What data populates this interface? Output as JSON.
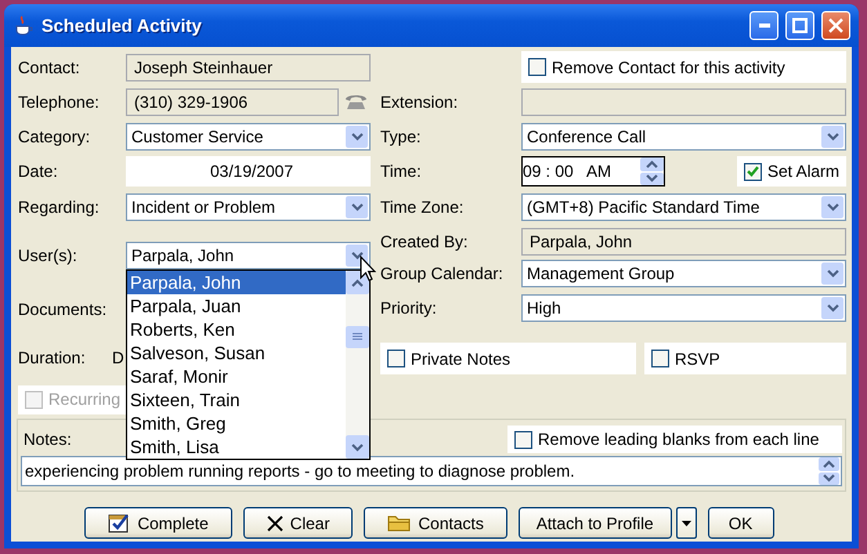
{
  "window": {
    "title": "Scheduled Activity"
  },
  "contact": {
    "label": "Contact:",
    "value": "Joseph Steinhauer"
  },
  "remove_contact": {
    "label": "Remove Contact for this activity",
    "checked": false
  },
  "telephone": {
    "label": "Telephone:",
    "value": "(310) 329-1906"
  },
  "extension": {
    "label": "Extension:"
  },
  "category": {
    "label": "Category:",
    "value": "Customer Service"
  },
  "type": {
    "label": "Type:",
    "value": "Conference Call"
  },
  "date": {
    "label": "Date:",
    "value": "03/19/2007"
  },
  "time": {
    "label": "Time:",
    "value": "09 : 00   AM"
  },
  "set_alarm": {
    "label": "Set Alarm",
    "checked": true
  },
  "regarding": {
    "label": "Regarding:",
    "value": "Incident or Problem"
  },
  "time_zone": {
    "label": "Time Zone:",
    "value": "(GMT+8) Pacific Standard Time"
  },
  "created_by": {
    "label": "Created By:",
    "value": "Parpala, John"
  },
  "users": {
    "label": "User(s):",
    "value": "Parpala, John",
    "expanded": true,
    "options": [
      {
        "label": "Parpala, John",
        "selected": true
      },
      {
        "label": "Parpala, Juan",
        "selected": false
      },
      {
        "label": "Roberts, Ken",
        "selected": false
      },
      {
        "label": "Salveson, Susan",
        "selected": false
      },
      {
        "label": "Saraf, Monir",
        "selected": false
      },
      {
        "label": "Sixteen, Train",
        "selected": false
      },
      {
        "label": "Smith, Greg",
        "selected": false
      },
      {
        "label": "Smith, Lisa",
        "selected": false
      }
    ]
  },
  "group_calendar": {
    "label": "Group Calendar:",
    "value": "Management Group"
  },
  "documents": {
    "label": "Documents:"
  },
  "priority": {
    "label": "Priority:",
    "value": "High"
  },
  "duration": {
    "label": "Duration:",
    "value": "D"
  },
  "private_notes": {
    "label": "Private Notes",
    "checked": false
  },
  "rsvp": {
    "label": "RSVP",
    "checked": false
  },
  "recurring": {
    "label": "Recurring",
    "checked": false,
    "disabled": true
  },
  "notes": {
    "label": "Notes:",
    "value": "experiencing problem running reports - go to meeting to diagnose problem.",
    "remove_blanks": {
      "label": "Remove leading blanks from each line",
      "checked": false
    }
  },
  "buttons": [
    {
      "label": "Complete",
      "kind": "complete"
    },
    {
      "label": "Clear",
      "kind": "clear"
    },
    {
      "label": "Contacts",
      "kind": "contacts"
    },
    {
      "label": "Attach to Profile",
      "kind": "plain",
      "menu": true
    },
    {
      "label": "OK",
      "kind": "plain"
    }
  ]
}
